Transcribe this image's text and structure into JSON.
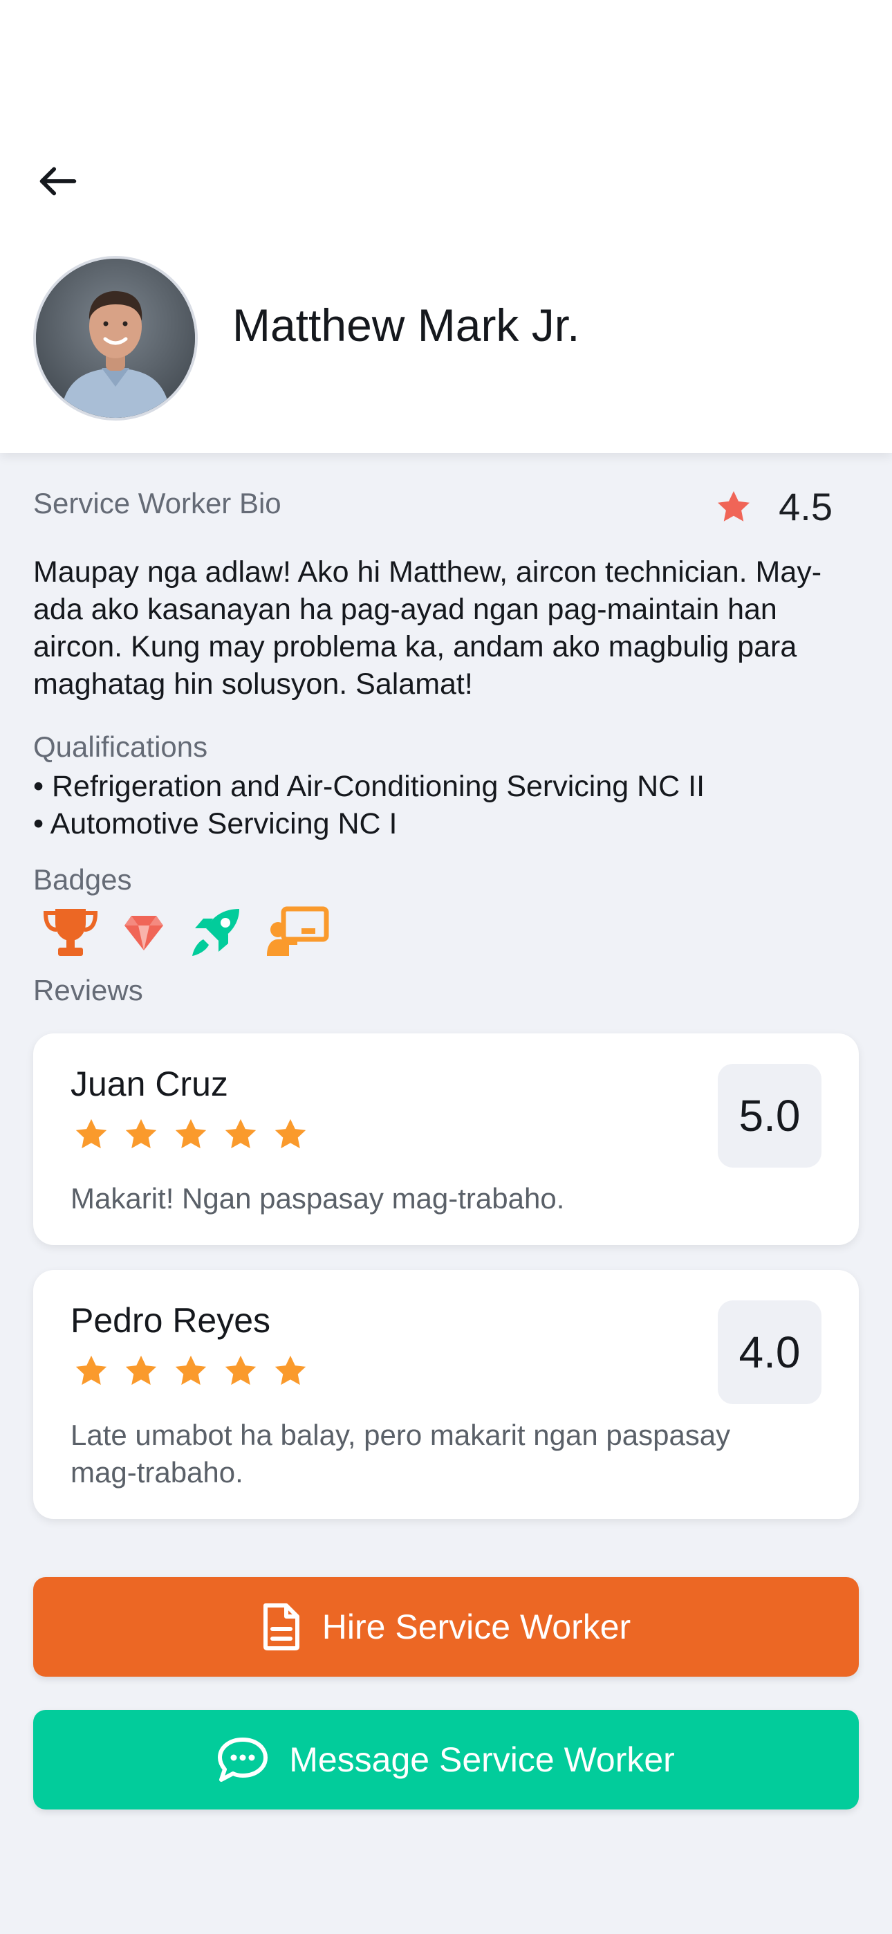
{
  "header": {
    "back_icon": "arrow-left-icon",
    "worker_name": "Matthew Mark Jr."
  },
  "bio": {
    "label": "Service Worker Bio",
    "rating": "4.5",
    "text": "Maupay nga adlaw! Ako hi Matthew, aircon technician. May-ada ako kasanayan ha pag-ayad ngan pag-maintain han aircon. Kung may problema ka, andam ako magbulig para maghatag hin solusyon. Salamat!"
  },
  "qualifications": {
    "label": "Qualifications",
    "items": [
      "• Refrigeration and Air-Conditioning Servicing NC II",
      "• Automotive Servicing NC I"
    ]
  },
  "badges": {
    "label": "Badges",
    "items": [
      "trophy-icon",
      "gem-icon",
      "rocket-icon",
      "teacher-icon"
    ]
  },
  "reviews": {
    "label": "Reviews",
    "items": [
      {
        "name": "Juan Cruz",
        "score": "5.0",
        "stars": 5,
        "text": "Makarit! Ngan paspasay mag-trabaho."
      },
      {
        "name": "Pedro Reyes",
        "score": "4.0",
        "stars": 5,
        "text": "Late umabot ha balay, pero makarit ngan paspasay mag-trabaho."
      }
    ]
  },
  "actions": {
    "hire_label": "Hire Service Worker",
    "message_label": "Message Service Worker"
  },
  "colors": {
    "orange": "#ec6724",
    "teal": "#02cc9b",
    "star": "#fa9a2c",
    "rating_star": "#f06557"
  }
}
